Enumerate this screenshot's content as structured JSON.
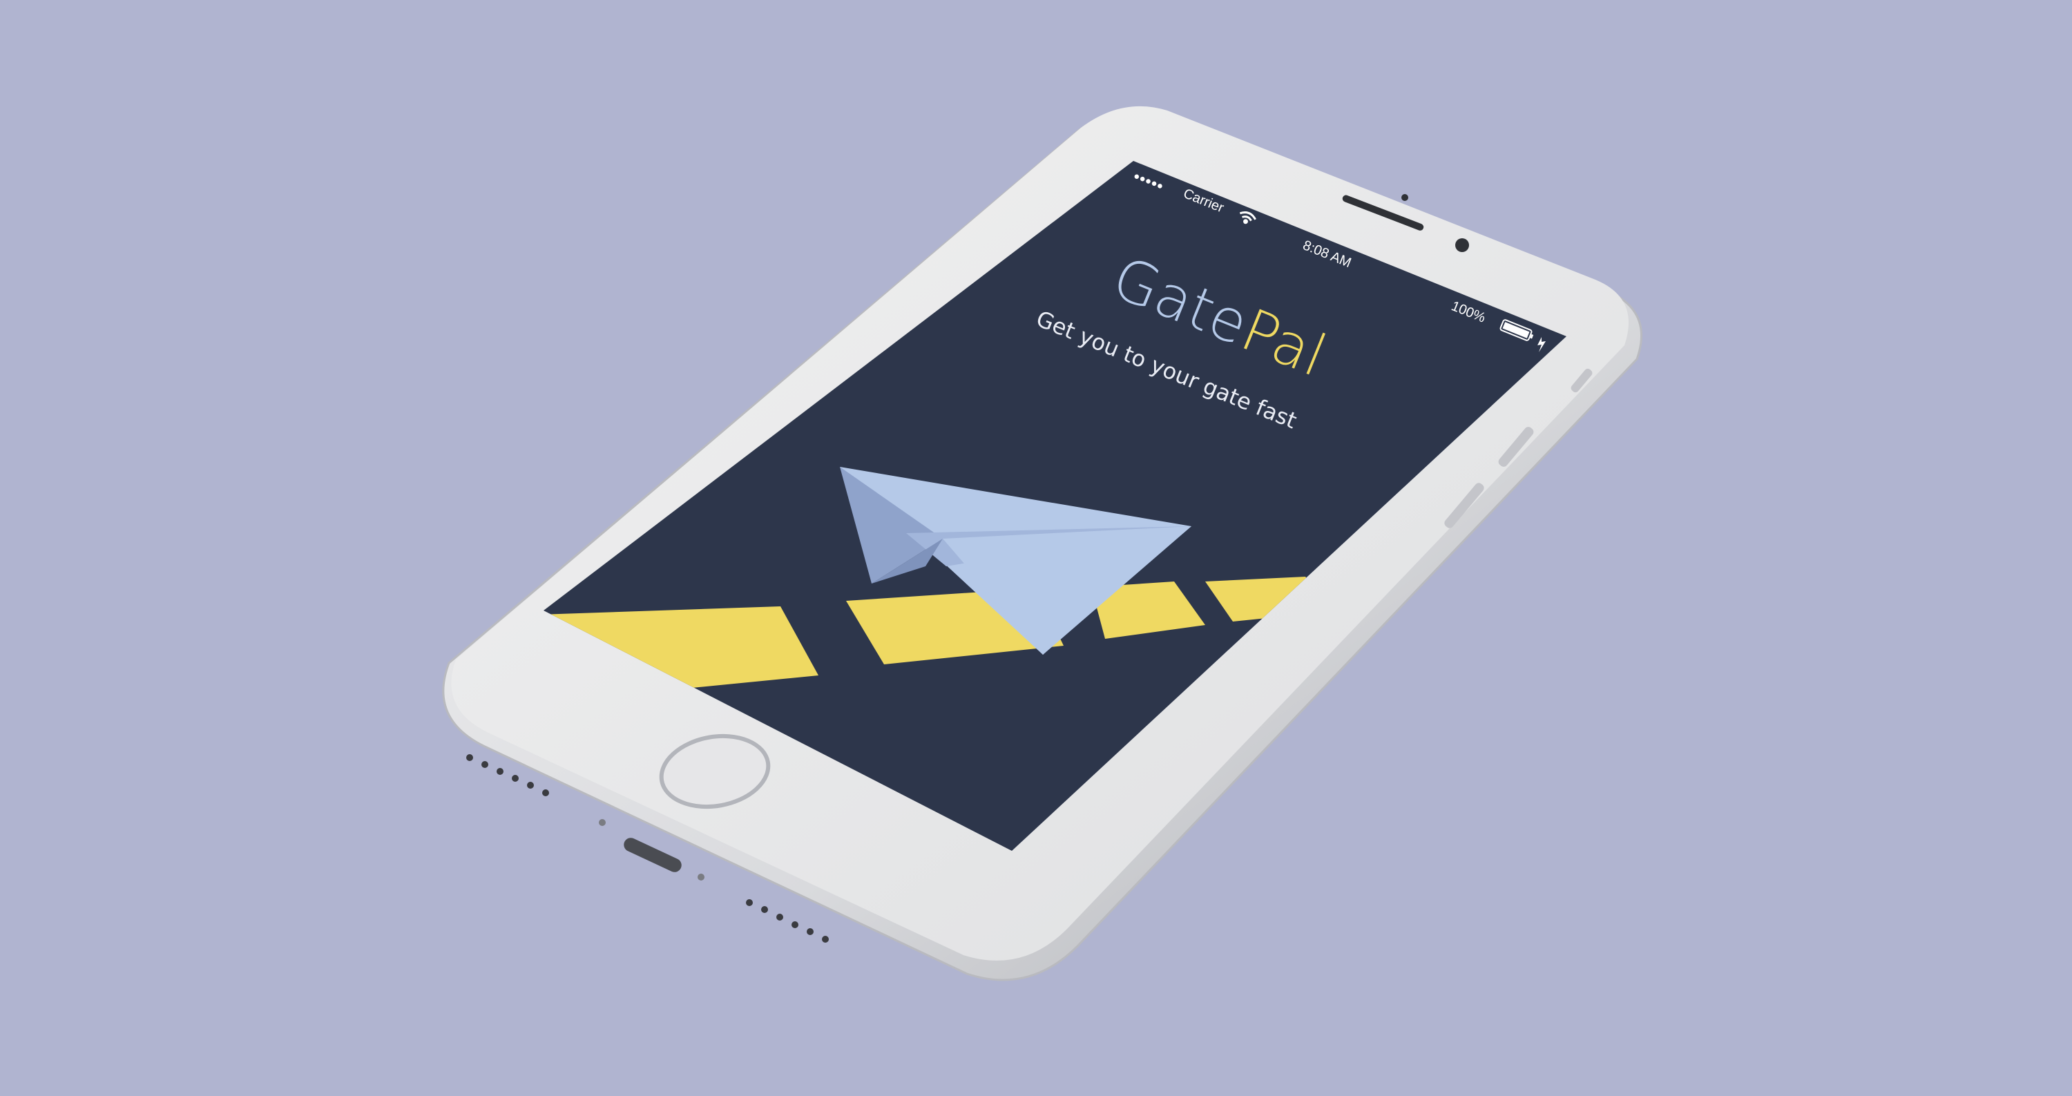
{
  "colors": {
    "background": "#b0b4d0",
    "screen": "#2d364b",
    "accent_yellow": "#efd962",
    "plane_light": "#b5c9e8",
    "plane_dark": "#8fa3cb",
    "title_gate": "#b5c9e8",
    "phone_body": "#e8e8ea",
    "phone_frame": "#cfd0d4"
  },
  "status_bar": {
    "signal_dots": "●●●●●",
    "carrier": "Carrier",
    "wifi_icon": "wifi-icon",
    "time": "8:08 AM",
    "battery_percent": "100%",
    "battery_icon": "battery-icon",
    "charging_icon": "bolt-icon"
  },
  "app": {
    "title_part1": "Gate",
    "title_part2": "Pal",
    "tagline": "Get you to your gate fast"
  },
  "illustration": {
    "plane_icon": "paper-plane-icon",
    "runway_icon": "runway-stripes"
  },
  "hardware": {
    "home_button": "home-button",
    "speaker": "earpiece-speaker",
    "camera": "front-camera"
  }
}
